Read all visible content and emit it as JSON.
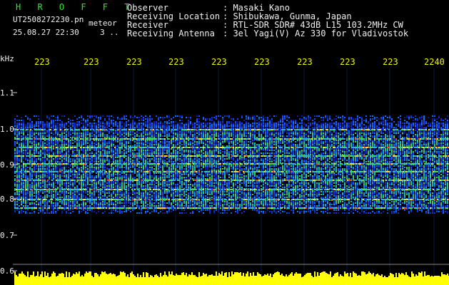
{
  "header": {
    "title": "H R O F F T",
    "filename": "UT2508272230.pn",
    "meteor": "meteor",
    "date_time": "25.08.27 22:30",
    "count": "3 ..",
    "labels": {
      "observer": "Observer",
      "location": "Receiving Location",
      "receiver": "Receiver",
      "antenna": "Receiving Antenna"
    },
    "values": {
      "observer": ": Masaki Kano",
      "location": ": Shibukawa, Gunma, Japan",
      "receiver": ": RTL-SDR SDR# 43dB L15 103.2MHz CW",
      "antenna": ": 3el Yagi(V) Az 330 for Vladivostok"
    }
  },
  "time_axis": {
    "ticks": [
      "223",
      "223",
      "223",
      "223",
      "223",
      "223",
      "223",
      "223",
      "223",
      "2240"
    ]
  },
  "freq_axis": {
    "unit": "kHz",
    "ticks": [
      "1.1",
      "1.0",
      "0.9",
      "0.8",
      "0.7",
      "0.6"
    ]
  },
  "colors": {
    "background": "#000000",
    "header_green": "#2ee82e",
    "tick_yellow": "#f2f200",
    "noise_blue": "#1030d0",
    "strip_yellow": "#ffff00"
  }
}
